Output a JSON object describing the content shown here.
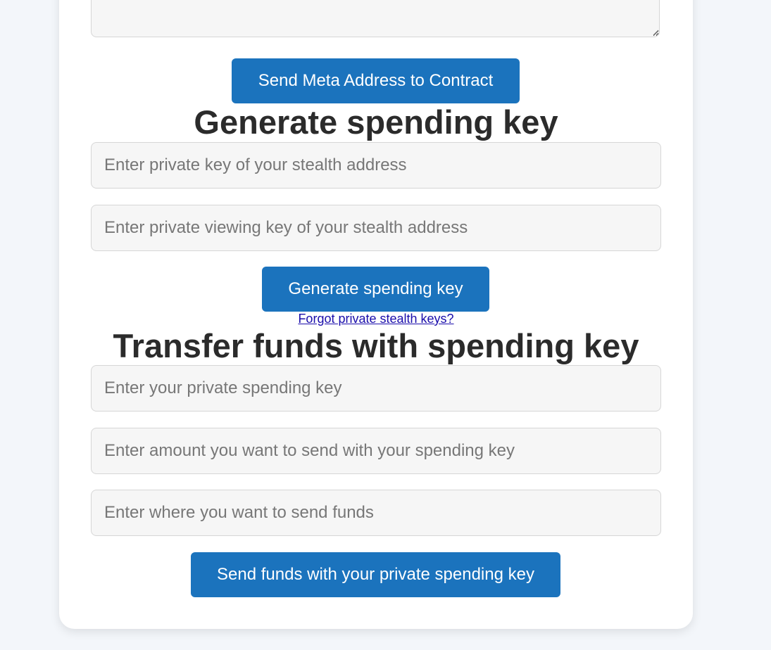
{
  "meta_section": {
    "textarea_value": "",
    "send_button_label": "Send Meta Address to Contract"
  },
  "generate_section": {
    "title": "Generate spending key",
    "private_key_placeholder": "Enter private key of your stealth address",
    "viewing_key_placeholder": "Enter private viewing key of your stealth address",
    "button_label": "Generate spending key",
    "forgot_link": "Forgot private stealth keys?"
  },
  "transfer_section": {
    "title": "Transfer funds with spending key",
    "spending_key_placeholder": "Enter your private spending key",
    "amount_placeholder": "Enter amount you want to send with your spending key",
    "recipient_placeholder": "Enter where you want to send funds",
    "button_label": "Send funds with your private spending key"
  },
  "colors": {
    "primary_button": "#1b73bd",
    "background": "#f3f6fa",
    "card": "#ffffff",
    "link": "#1a0dab"
  }
}
